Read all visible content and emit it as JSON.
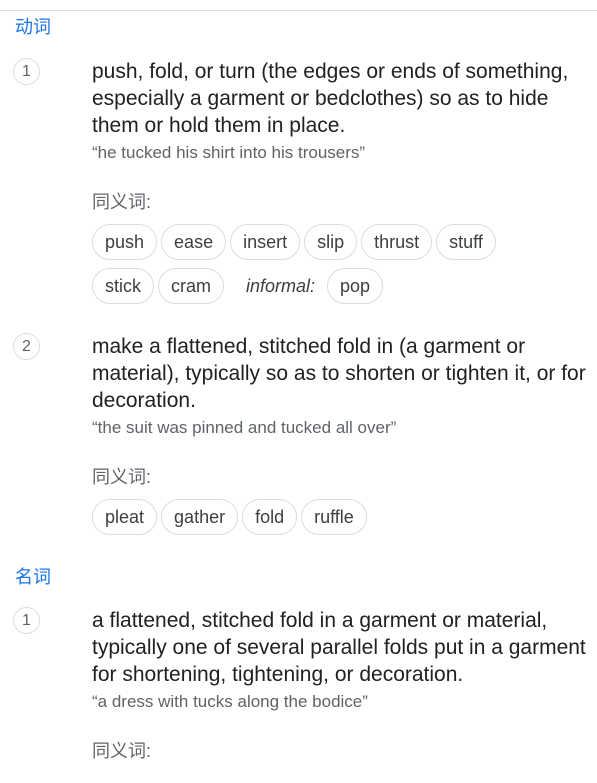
{
  "verb": {
    "label": "动词",
    "senses": [
      {
        "number": "1",
        "definition": "push, fold, or turn (the edges or ends of something, especially a garment or bedclothes) so as to hide them or hold them in place.",
        "example": "“he tucked his shirt into his trousers”",
        "synonyms_heading": "同义词:",
        "synonyms_row1": [
          "push",
          "ease",
          "insert",
          "slip",
          "thrust",
          "stuff"
        ],
        "synonyms_row2": [
          "stick",
          "cram"
        ],
        "register_label": "informal:",
        "register_synonyms": [
          "pop"
        ]
      },
      {
        "number": "2",
        "definition": "make a flattened, stitched fold in (a garment or material), typically so as to shorten or tighten it, or for decoration.",
        "example": "“the suit was pinned and tucked all over”",
        "synonyms_heading": "同义词:",
        "synonyms_row1": [
          "pleat",
          "gather",
          "fold",
          "ruffle"
        ]
      }
    ]
  },
  "noun": {
    "label": "名词",
    "senses": [
      {
        "number": "1",
        "definition": "a flattened, stitched fold in a garment or material, typically one of several parallel folds put in a garment for shortening, tightening, or decoration.",
        "example": "“a dress with tucks along the bodice”",
        "synonyms_heading": "同义词:"
      }
    ]
  }
}
